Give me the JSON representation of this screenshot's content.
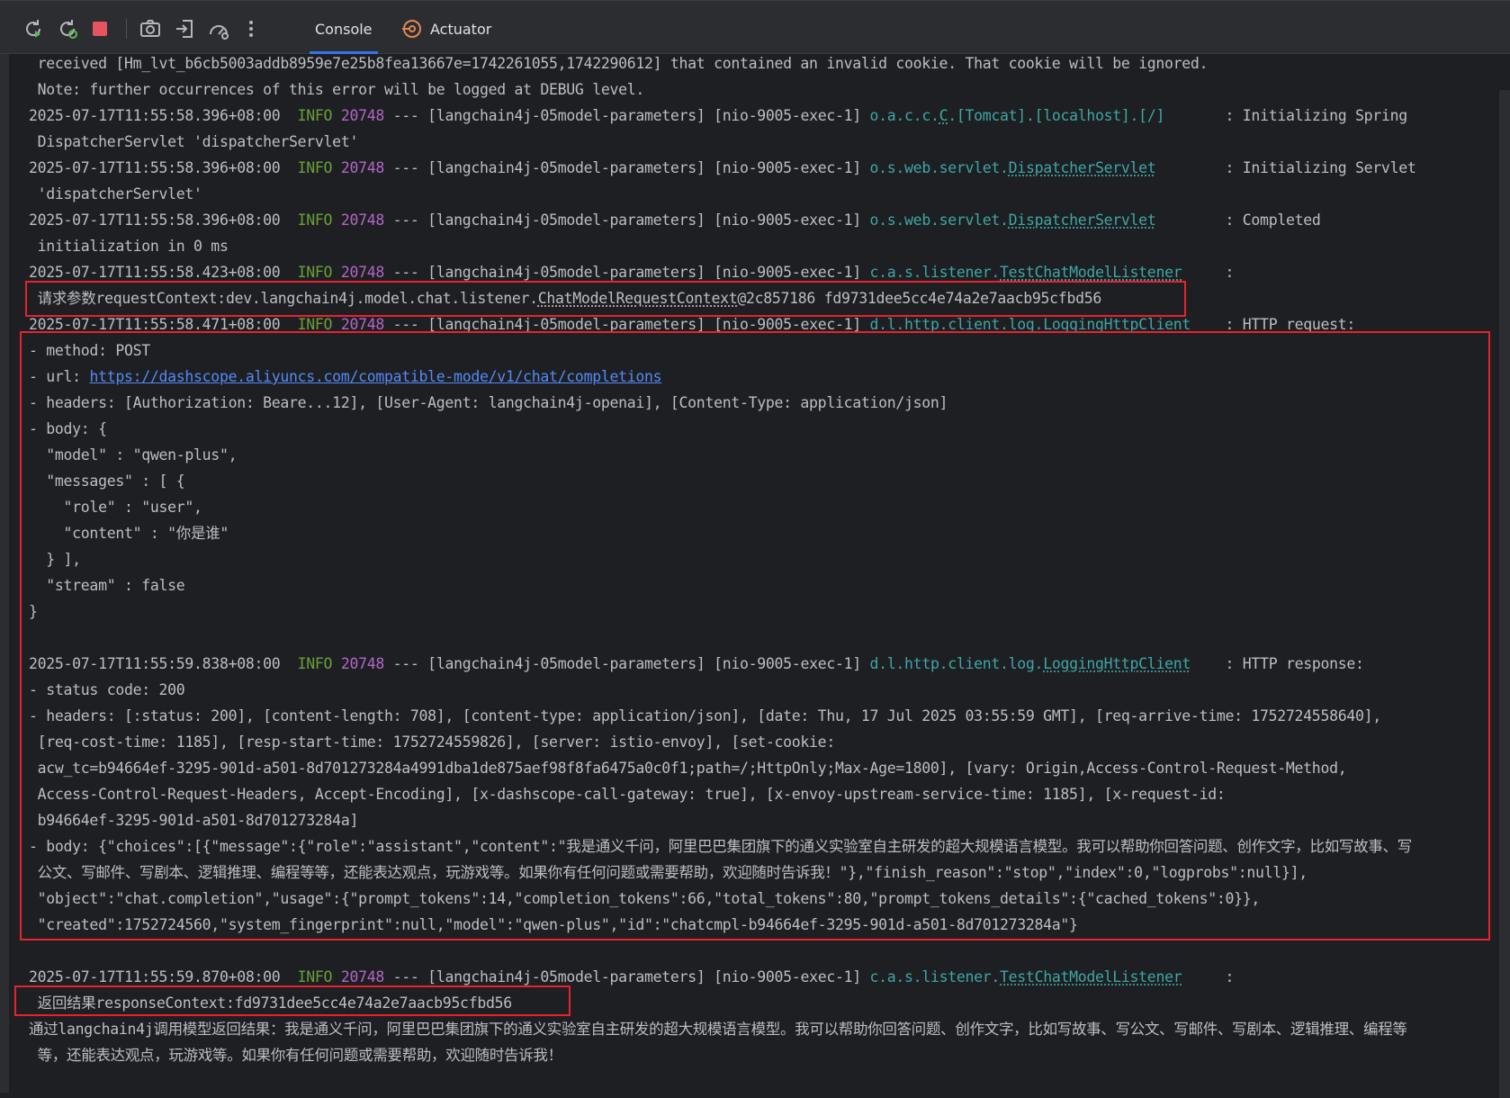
{
  "toolbar": {
    "tabs": [
      {
        "label": "Console",
        "active": true
      },
      {
        "label": "Actuator",
        "active": false
      }
    ],
    "icons": [
      "rerun-icon",
      "rerun-failed-icon",
      "stop-icon",
      "camera-icon",
      "login-icon",
      "gauge-icon",
      "more-icon"
    ]
  },
  "colors": {
    "background": "#1e1f22",
    "info": "#6a9f3a",
    "pid": "#b366c7",
    "logger": "#3ea6a6",
    "link": "#548af7",
    "highlight": "#e8222d",
    "stop": "#e55561"
  },
  "log": {
    "l1": " received [Hm_lvt_b6cb5003addb8959e7e25b8fea13667e=1742261055,1742290612] that contained an invalid cookie. That cookie will be ignored.",
    "l2": " Note: further occurrences of this error will be logged at DEBUG level.",
    "e1": {
      "ts": "2025-07-17T11:55:58.396+08:00  ",
      "level": "INFO",
      "pid": " 20748",
      "mid": " --- [langchain4j-05model-parameters] [nio-9005-exec-1] ",
      "logger_pre": "o.a.c.c.",
      "logger_u": "C",
      "logger_post": ".[Tomcat].[localhost].[/]",
      "msg": "       : Initializing Spring"
    },
    "e1c": " DispatcherServlet 'dispatcherServlet'",
    "e2": {
      "ts": "2025-07-17T11:55:58.396+08:00  ",
      "level": "INFO",
      "pid": " 20748",
      "mid": " --- [langchain4j-05model-parameters] [nio-9005-exec-1] ",
      "logger_pre": "o.s.web.servlet.",
      "logger_u": "DispatcherServlet",
      "msg": "        : Initializing Servlet"
    },
    "e2c": " 'dispatcherServlet'",
    "e3": {
      "ts": "2025-07-17T11:55:58.396+08:00  ",
      "level": "INFO",
      "pid": " 20748",
      "mid": " --- [langchain4j-05model-parameters] [nio-9005-exec-1] ",
      "logger_pre": "o.s.web.servlet.",
      "logger_u": "DispatcherServlet",
      "msg": "        : Completed"
    },
    "e3c": " initialization in 0 ms",
    "e4": {
      "ts": "2025-07-17T11:55:58.423+08:00  ",
      "level": "INFO",
      "pid": " 20748",
      "mid": " --- [langchain4j-05model-parameters] [nio-9005-exec-1] ",
      "logger_pre": "c.a.s.listener.",
      "logger_u": "TestChatModelListener",
      "msg": "     : "
    },
    "req_pre": " 请求参数requestContext:dev.langchain4j.model.chat.listener.",
    "req_u": "ChatModelRequestContext",
    "req_post": "@2c857186 fd9731dee5cc4e74a2e7aacb95cfbd56",
    "e5": {
      "ts": "2025-07-17T11:55:58.471+08:00  ",
      "level": "INFO",
      "pid": " 20748",
      "mid": " --- [langchain4j-05model-parameters] [nio-9005-exec-1] ",
      "logger_pre": "d.l.http.client.log.",
      "logger_u": "LoggingHttpClient",
      "msg": "    : HTTP request:"
    },
    "r1": "- method: POST",
    "r2_pre": "- url: ",
    "r2_url": "https://dashscope.aliyuncs.com/compatible-mode/v1/chat/completions",
    "r3": "- headers: [Authorization: Beare...12], [User-Agent: langchain4j-openai], [Content-Type: application/json]",
    "r4": "- body: {",
    "r5": "  \"model\" : \"qwen-plus\",",
    "r6": "  \"messages\" : [ {",
    "r7": "    \"role\" : \"user\",",
    "r8": "    \"content\" : \"你是谁\"",
    "r9": "  } ],",
    "r10": "  \"stream\" : false",
    "r11": "}",
    "e6": {
      "ts": "2025-07-17T11:55:59.838+08:00  ",
      "level": "INFO",
      "pid": " 20748",
      "mid": " --- [langchain4j-05model-parameters] [nio-9005-exec-1] ",
      "logger_pre": "d.l.http.client.log.",
      "logger_u": "LoggingHttpClient",
      "msg": "    : HTTP response:"
    },
    "s1": "- status code: 200",
    "s2": "- headers: [:status: 200], [content-length: 708], [content-type: application/json], [date: Thu, 17 Jul 2025 03:55:59 GMT], [req-arrive-time: 1752724558640],",
    "s3": " [req-cost-time: 1185], [resp-start-time: 1752724559826], [server: istio-envoy], [set-cookie:",
    "s4": " acw_tc=b94664ef-3295-901d-a501-8d701273284a4991dba1de875aef98f8fa6475a0c0f1;path=/;HttpOnly;Max-Age=1800], [vary: Origin,Access-Control-Request-Method,",
    "s5": " Access-Control-Request-Headers, Accept-Encoding], [x-dashscope-call-gateway: true], [x-envoy-upstream-service-time: 1185], [x-request-id:",
    "s6": " b94664ef-3295-901d-a501-8d701273284a]",
    "s7": "- body: {\"choices\":[{\"message\":{\"role\":\"assistant\",\"content\":\"我是通义千问，阿里巴巴集团旗下的通义实验室自主研发的超大规模语言模型。我可以帮助你回答问题、创作文字，比如写故事、写",
    "s8": " 公文、写邮件、写剧本、逻辑推理、编程等等，还能表达观点，玩游戏等。如果你有任何问题或需要帮助，欢迎随时告诉我！\"},\"finish_reason\":\"stop\",\"index\":0,\"logprobs\":null}],",
    "s9": " \"object\":\"chat.completion\",\"usage\":{\"prompt_tokens\":14,\"completion_tokens\":66,\"total_tokens\":80,\"prompt_tokens_details\":{\"cached_tokens\":0}},",
    "s10": " \"created\":1752724560,\"system_fingerprint\":null,\"model\":\"qwen-plus\",\"id\":\"chatcmpl-b94664ef-3295-901d-a501-8d701273284a\"}",
    "e7": {
      "ts": "2025-07-17T11:55:59.870+08:00  ",
      "level": "INFO",
      "pid": " 20748",
      "mid": " --- [langchain4j-05model-parameters] [nio-9005-exec-1] ",
      "logger_pre": "c.a.s.listener.",
      "logger_u": "TestChatModelListener",
      "msg": "     :"
    },
    "resp": " 返回结果responseContext:fd9731dee5cc4e74a2e7aacb95cfbd56",
    "f1": "通过langchain4j调用模型返回结果：我是通义千问，阿里巴巴集团旗下的通义实验室自主研发的超大规模语言模型。我可以帮助你回答问题、创作文字，比如写故事、写公文、写邮件、写剧本、逻辑推理、编程等",
    "f2": " 等，还能表达观点，玩游戏等。如果你有任何问题或需要帮助，欢迎随时告诉我！"
  }
}
